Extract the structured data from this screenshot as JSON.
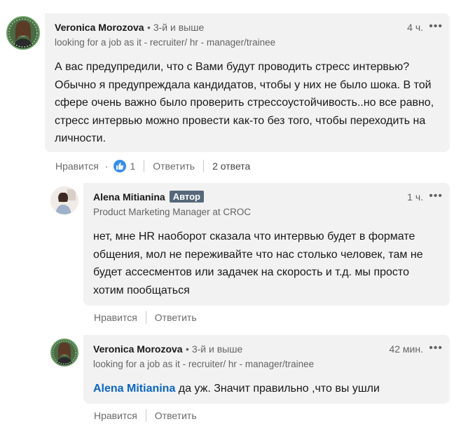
{
  "comments": [
    {
      "author": "Veronica Morozova",
      "degree": "• 3-й и выше",
      "headline": "looking for a job as it - recruiter/ hr - manager/trainee",
      "time": "4 ч.",
      "more": "•••",
      "text": "А вас предупредили, что с Вами будут проводить стресс интервью? Обычно я предупреждала кандидатов, чтобы у них не было шока. В той сфере очень важно было проверить стрессоустойчивость..но все равно, стресс интервью можно провести как-то без того, чтобы переходить на личности.",
      "like_label": "Нравится",
      "dot": "·",
      "reaction_count": "1",
      "reply_label": "Ответить",
      "replies_count": "2 ответа",
      "avatar_color": "#3a5a3c"
    },
    {
      "author": "Alena Mitianina",
      "badge": "Автор",
      "headline": "Product Marketing Manager at CROC",
      "time": "1 ч.",
      "more": "•••",
      "text": "нет, мне HR наоборот сказала что интервью будет в формате общения, мол не переживайте что нас столько человек, там не будет ассесментов или задачек на скорость и т.д. мы просто хотим пообщаться",
      "like_label": "Нравится",
      "reply_label": "Ответить"
    },
    {
      "author": "Veronica Morozova",
      "degree": "• 3-й и выше",
      "headline": "looking for a job as it - recruiter/ hr - manager/trainee",
      "time": "42 мин.",
      "more": "•••",
      "mention": "Alena Mitianina",
      "text": " да уж. Значит правильно ,что вы ушли",
      "like_label": "Нравится",
      "reply_label": "Ответить"
    }
  ],
  "colors": {
    "bubble": "#f2f2f2",
    "link": "#0a66c2",
    "badge": "#56687a",
    "like_icon": "#378fe9"
  }
}
